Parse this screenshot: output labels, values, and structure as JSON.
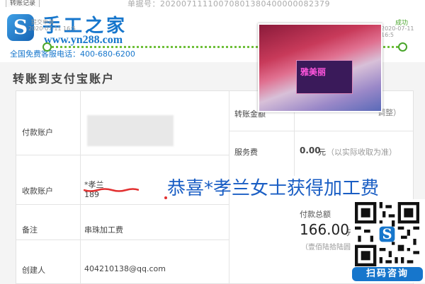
{
  "topbar": {
    "tab_label": "转账记录",
    "order_number": "单据号：20200711110070801380400000082379"
  },
  "header": {
    "brand": "手工之家",
    "url": "www.yn288.com",
    "hotline": "全国免费客服电话：400-680-6200",
    "logo_glyph": "S"
  },
  "progress": {
    "start_label": "提交申请",
    "start_date": "2020-07-11 16:5",
    "end_label": "成功",
    "end_date": "2020-07-11 16:5",
    "color": "#48a52a"
  },
  "panel": {
    "title": "转账到支付宝账户"
  },
  "rows": {
    "payer_label": "付款账户",
    "payee_label": "收款账户",
    "payee_name": "*孝兰",
    "payee_account": "189",
    "note_label": "备注",
    "note_value": "串珠加工费",
    "creator_label": "创建人",
    "creator_value": "404210138@qq.com",
    "amount_label": "转账金额",
    "amount_hint": "调整）",
    "fee_label": "服务费",
    "fee_value": "0.00",
    "fee_unit": "元",
    "fee_note": "（以实际收取为准）",
    "total_label": "付款总额",
    "total_value": "166.00",
    "total_unit": "元",
    "total_upper": "（壹佰陆拾陆圆整）"
  },
  "overlay": {
    "congrats": "恭喜*孝兰女士获得加工费"
  },
  "photo": {
    "box_text": "雅美丽"
  },
  "qr": {
    "button": "扫码咨询"
  },
  "colors": {
    "brand": "#1676cc",
    "overlay": "#1a5ec4",
    "accent_green": "#48a52a"
  }
}
